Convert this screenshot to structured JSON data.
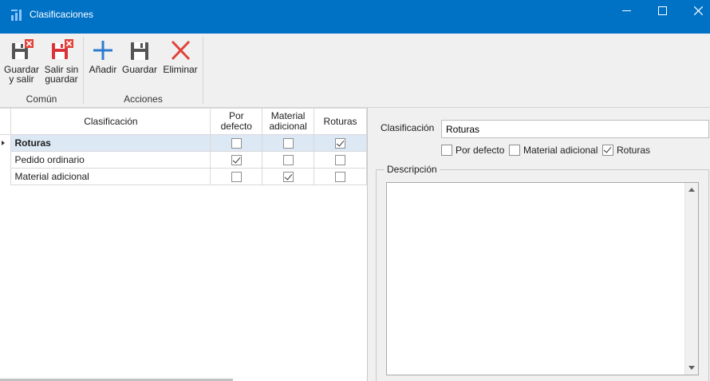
{
  "window": {
    "title": "Clasificaciones",
    "icon": "app-chart-icon",
    "controls": {
      "minimize": "—",
      "maximize": "☐",
      "close": "✕"
    }
  },
  "ribbon": {
    "buttons": {
      "save_exit": {
        "line1": "Guardar",
        "line2": "y salir",
        "icon": "save-exit-icon"
      },
      "exit_no_save": {
        "line1": "Salir sin",
        "line2": "guardar",
        "icon": "exit-nosave-icon"
      },
      "add": {
        "label": "Añadir",
        "icon": "plus-icon"
      },
      "save": {
        "label": "Guardar",
        "icon": "save-icon"
      },
      "delete": {
        "label": "Eliminar",
        "icon": "x-delete-icon"
      }
    },
    "groups": {
      "common": "Común",
      "actions": "Acciones"
    }
  },
  "grid": {
    "columns": [
      "Clasificación",
      "Por defecto",
      "Material adicional",
      "Roturas"
    ],
    "column_lines": {
      "por_defecto": [
        "Por",
        "defecto"
      ],
      "material": [
        "Material",
        "adicional"
      ]
    },
    "rows": [
      {
        "name": "Roturas",
        "por_defecto": false,
        "material": false,
        "roturas": true,
        "selected": true
      },
      {
        "name": "Pedido ordinario",
        "por_defecto": true,
        "material": false,
        "roturas": false,
        "selected": false
      },
      {
        "name": "Material adicional",
        "por_defecto": false,
        "material": true,
        "roturas": false,
        "selected": false
      }
    ]
  },
  "detail": {
    "clasificacion_label": "Clasificación",
    "clasificacion_value": "Roturas",
    "options": {
      "por_defecto": {
        "label": "Por defecto",
        "checked": false
      },
      "material": {
        "label": "Material adicional",
        "checked": false
      },
      "roturas": {
        "label": "Roturas",
        "checked": true
      }
    },
    "descripcion_label": "Descripción",
    "descripcion_value": ""
  },
  "colors": {
    "titlebar": "#0072c6",
    "selected_row": "#dde8f5",
    "delete_red": "#e0443a",
    "add_blue": "#2e7bcf"
  }
}
